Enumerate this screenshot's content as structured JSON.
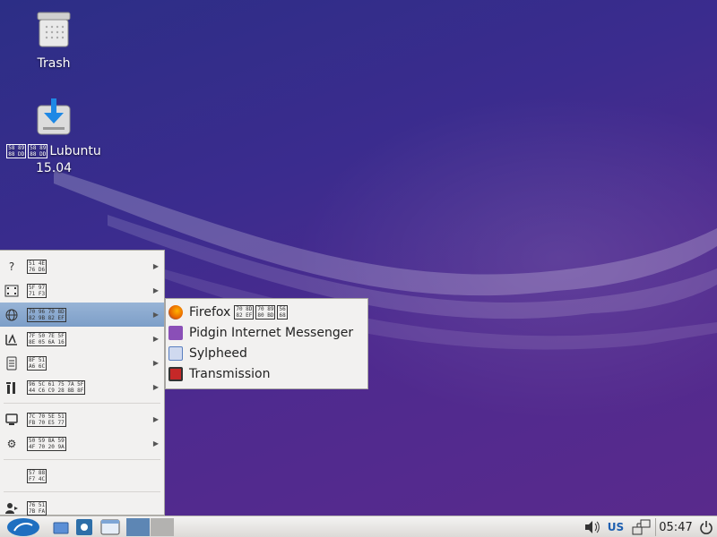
{
  "desktop": {
    "icons": [
      {
        "name": "trash",
        "label": "Trash"
      },
      {
        "name": "lubuntu",
        "label_hex": [
          "58",
          "89",
          "88",
          "DD"
        ],
        "label": "Lubuntu",
        "label2": "15.04"
      }
    ]
  },
  "menu": {
    "items": [
      {
        "id": "help",
        "icon": "question-icon",
        "hex": [
          "51 4E",
          "76 D6"
        ],
        "has_submenu": true
      },
      {
        "id": "multimedia",
        "icon": "film-icon",
        "hex": [
          "5F 97",
          "71 F3"
        ],
        "has_submenu": true
      },
      {
        "id": "internet",
        "icon": "globe-icon",
        "hex": [
          "70 96 70 8D",
          "82 9B 82 EF"
        ],
        "has_submenu": true,
        "active": true
      },
      {
        "id": "graphics",
        "icon": "graphics-icon",
        "hex": [
          "7F 50 7E 5F",
          "8E 05 6A 16"
        ],
        "has_submenu": true
      },
      {
        "id": "office",
        "icon": "document-icon",
        "hex": [
          "8F 51",
          "A6 6C"
        ],
        "has_submenu": true
      },
      {
        "id": "accessories",
        "icon": "tools-icon",
        "hex": [
          "96 5C 61 75 7A 5F",
          "44 C6 C9 28 8B 8F"
        ],
        "has_submenu": true
      },
      {
        "id": "system",
        "icon": "monitor-icon",
        "hex": [
          "7C 70 5E 51",
          "FB 70 E5 77"
        ],
        "has_submenu": true
      },
      {
        "id": "preferences",
        "icon": "gear-icon",
        "hex": [
          "50 59 8A 59",
          "4F 70 20 9A"
        ],
        "has_submenu": true
      },
      {
        "id": "run",
        "icon": "none",
        "hex": [
          "57 88",
          "F7 4C"
        ],
        "has_submenu": false
      },
      {
        "id": "logout",
        "icon": "logout-icon",
        "hex": [
          "76 51",
          "7B FA"
        ],
        "has_submenu": false
      }
    ]
  },
  "submenu": {
    "items": [
      {
        "id": "firefox",
        "label": "Firefox",
        "hex": [
          "70 8D 70 89 56",
          "82 EF 80 BD 68"
        ],
        "icon": "firefox-icon",
        "color": "#e66000"
      },
      {
        "id": "pidgin",
        "label": "Pidgin Internet Messenger",
        "icon": "pidgin-icon",
        "color": "#8a4fb7"
      },
      {
        "id": "sylpheed",
        "label": "Sylpheed",
        "icon": "sylpheed-icon",
        "color": "#5a7fc0"
      },
      {
        "id": "transmission",
        "label": "Transmission",
        "icon": "transmission-icon",
        "color": "#c62828"
      }
    ]
  },
  "taskbar": {
    "keyboard_layout": "US",
    "clock": "05:47",
    "accent": "#1d5fb0"
  }
}
